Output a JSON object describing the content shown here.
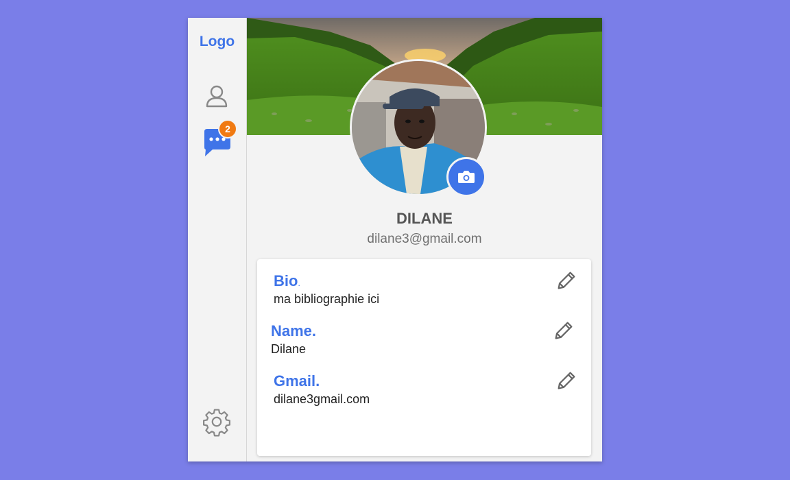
{
  "sidebar": {
    "logo": "Logo",
    "nav": [
      {
        "icon": "user-icon",
        "label": ""
      },
      {
        "icon": "chat-icon",
        "badge": "2"
      }
    ],
    "settings_icon": "gear-icon"
  },
  "profile": {
    "name": "DILANE",
    "email": "dilane3@gmail.com"
  },
  "fields": [
    {
      "label": "Bio",
      "dot": ".",
      "value": "ma bibliographie ici"
    },
    {
      "label": "Name.",
      "value": "Dilane"
    },
    {
      "label": "Gmail.",
      "value": "dilane3gmail.com"
    }
  ],
  "colors": {
    "background": "#7a7ee8",
    "accent": "#3f74e8",
    "badge": "#f07a12",
    "panel": "#f3f3f3"
  }
}
